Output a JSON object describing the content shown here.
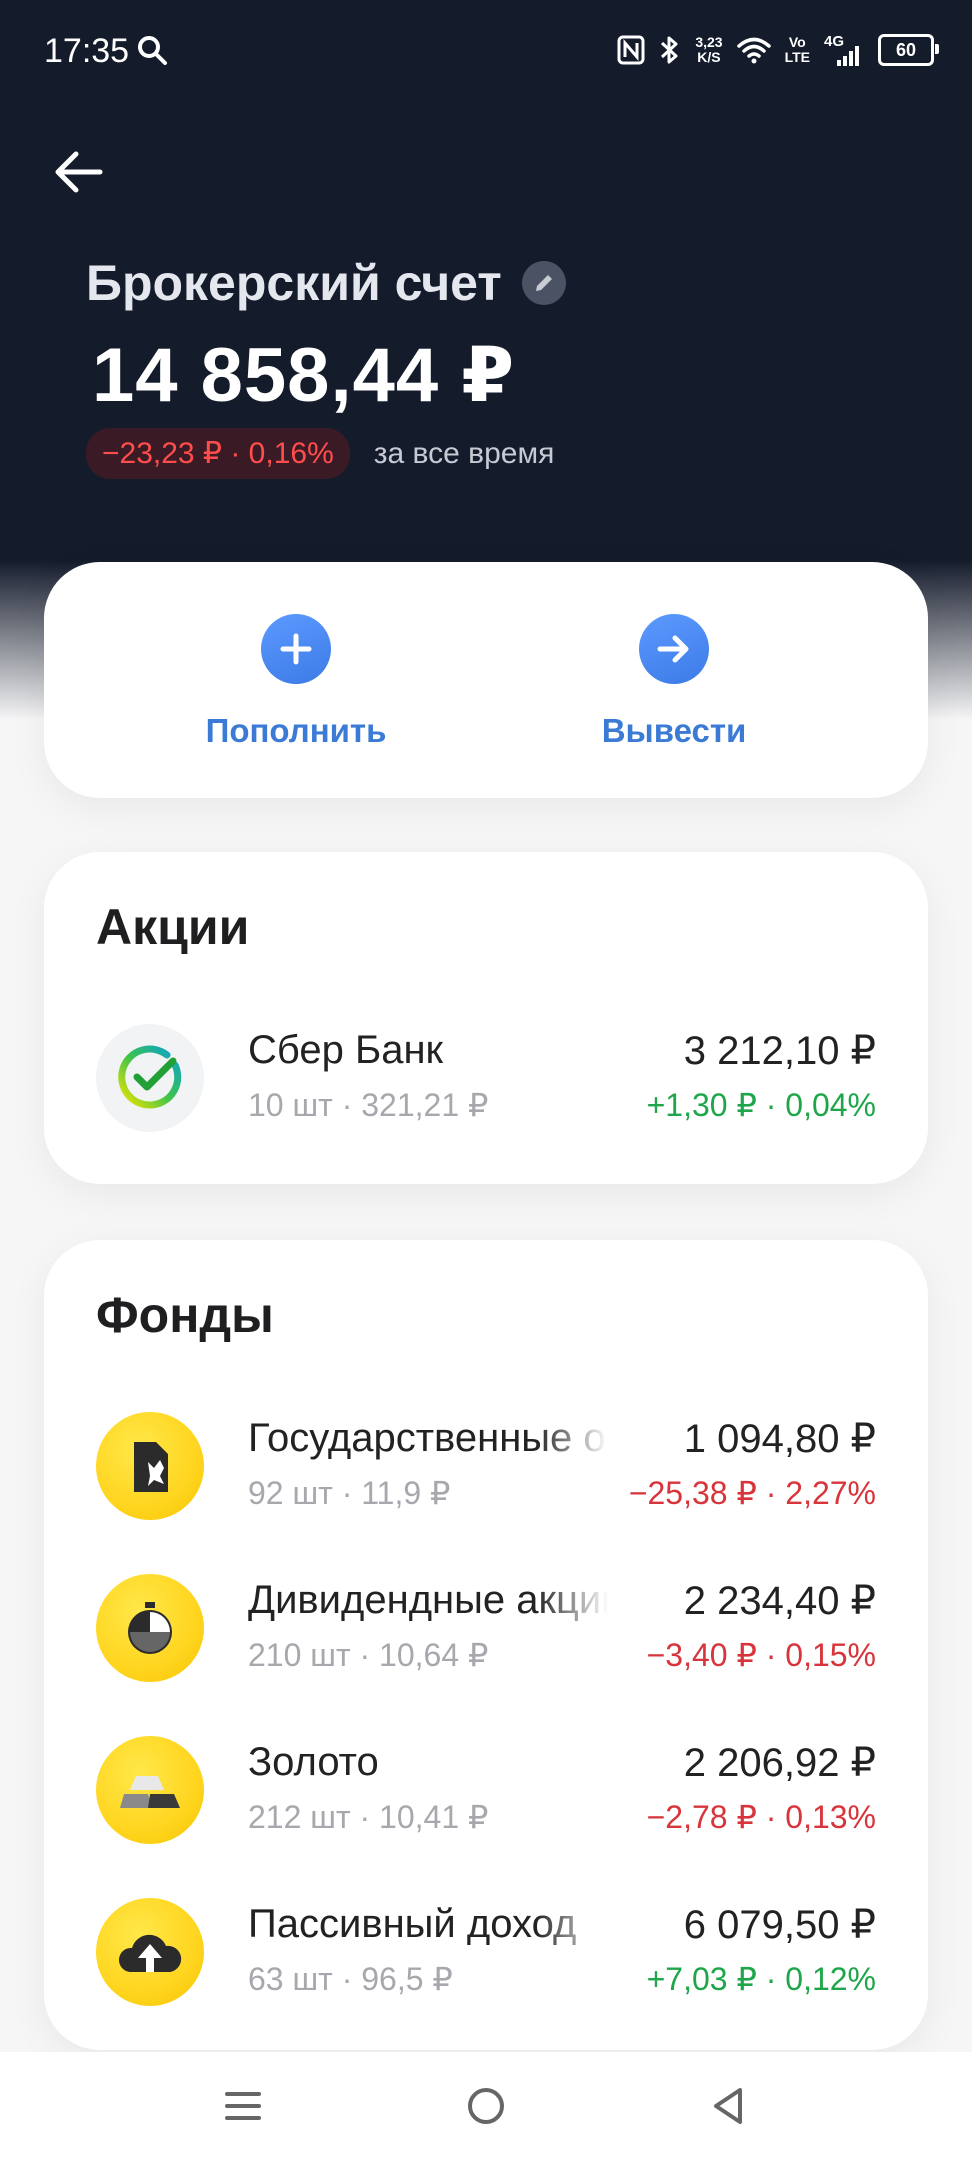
{
  "status_bar": {
    "time": "17:35",
    "speed_value": "3,23",
    "speed_unit": "K/S",
    "vo": "Vo",
    "lte": "LTE",
    "network": "4G",
    "battery": "60"
  },
  "account": {
    "title": "Брокерский счет",
    "balance": "14 858,44 ₽",
    "change": "−23,23 ₽ · 0,16%",
    "change_period": "за все время"
  },
  "actions": {
    "deposit_label": "Пополнить",
    "withdraw_label": "Вывести"
  },
  "stocks": {
    "title": "Акции",
    "items": [
      {
        "name": "Сбер Банк",
        "sub": "10 шт · 321,21 ₽",
        "value": "3 212,10 ₽",
        "delta": "+1,30 ₽ · 0,04%"
      }
    ]
  },
  "funds": {
    "title": "Фонды",
    "items": [
      {
        "name": "Государственные облигации",
        "sub": "92 шт · 11,9 ₽",
        "value": "1 094,80 ₽",
        "delta": "−25,38 ₽ · 2,27%"
      },
      {
        "name": "Дивидендные акции",
        "sub": "210 шт · 10,64 ₽",
        "value": "2 234,40 ₽",
        "delta": "−3,40 ₽ · 0,15%"
      },
      {
        "name": "Золото",
        "sub": "212 шт · 10,41 ₽",
        "value": "2 206,92 ₽",
        "delta": "−2,78 ₽ · 0,13%"
      },
      {
        "name": "Пассивный доход",
        "sub": "63 шт · 96,5 ₽",
        "value": "6 079,50 ₽",
        "delta": "+7,03 ₽ · 0,12%"
      }
    ]
  },
  "colors": {
    "header_bg": "#141b2b",
    "accent_blue": "#3b7bd6",
    "positive": "#1fa64a",
    "negative": "#d8343b",
    "fund_yellow": "#ffd51f"
  },
  "icons": {
    "back": "arrow-left-icon",
    "edit": "pencil-icon",
    "deposit": "plus-icon",
    "withdraw": "arrow-right-icon",
    "nav_menu": "menu-icon",
    "nav_home": "home-circle-icon",
    "nav_back": "back-triangle-icon"
  }
}
